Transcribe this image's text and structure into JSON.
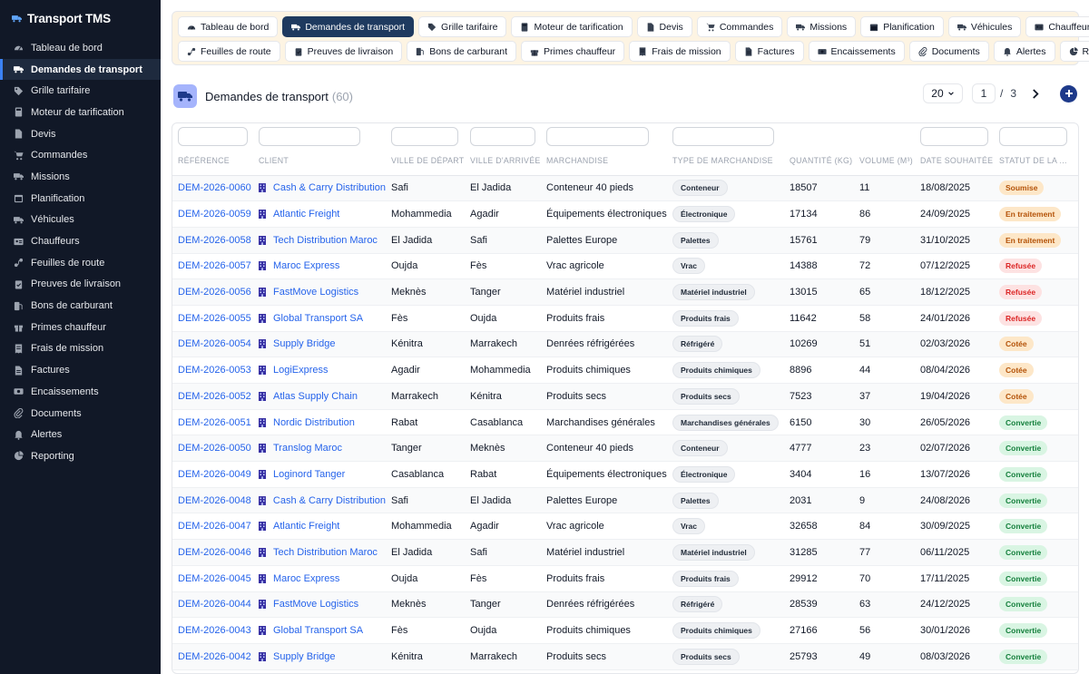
{
  "app": {
    "brand": "Transport TMS"
  },
  "sidebar": {
    "items": [
      {
        "label": "Tableau de bord",
        "icon": "dashboard-icon",
        "active": false
      },
      {
        "label": "Demandes de transport",
        "icon": "truck-icon",
        "active": true
      },
      {
        "label": "Grille tarifaire",
        "icon": "tag-icon",
        "active": false
      },
      {
        "label": "Moteur de tarification",
        "icon": "calculator-icon",
        "active": false
      },
      {
        "label": "Devis",
        "icon": "document-icon",
        "active": false
      },
      {
        "label": "Commandes",
        "icon": "cart-icon",
        "active": false
      },
      {
        "label": "Missions",
        "icon": "truck-icon",
        "active": false
      },
      {
        "label": "Planification",
        "icon": "calendar-icon",
        "active": false
      },
      {
        "label": "Véhicules",
        "icon": "truck-icon",
        "active": false
      },
      {
        "label": "Chauffeurs",
        "icon": "id-card-icon",
        "active": false
      },
      {
        "label": "Feuilles de route",
        "icon": "route-icon",
        "active": false
      },
      {
        "label": "Preuves de livraison",
        "icon": "clipboard-check-icon",
        "active": false
      },
      {
        "label": "Bons de carburant",
        "icon": "fuel-icon",
        "active": false
      },
      {
        "label": "Primes chauffeur",
        "icon": "gift-icon",
        "active": false
      },
      {
        "label": "Frais de mission",
        "icon": "receipt-icon",
        "active": false
      },
      {
        "label": "Factures",
        "icon": "invoice-icon",
        "active": false
      },
      {
        "label": "Encaissements",
        "icon": "money-icon",
        "active": false
      },
      {
        "label": "Documents",
        "icon": "paperclip-icon",
        "active": false
      },
      {
        "label": "Alertes",
        "icon": "bell-icon",
        "active": false
      },
      {
        "label": "Reporting",
        "icon": "pie-chart-icon",
        "active": false
      }
    ]
  },
  "tabs": {
    "row1": [
      {
        "label": "Tableau de bord",
        "icon": "dashboard-icon",
        "active": false
      },
      {
        "label": "Demandes de transport",
        "icon": "truck-icon",
        "active": true
      },
      {
        "label": "Grille tarifaire",
        "icon": "tag-icon",
        "active": false
      },
      {
        "label": "Moteur de tarification",
        "icon": "calculator-icon",
        "active": false
      },
      {
        "label": "Devis",
        "icon": "document-icon",
        "active": false
      },
      {
        "label": "Commandes",
        "icon": "cart-icon",
        "active": false
      },
      {
        "label": "Missions",
        "icon": "truck-icon",
        "active": false
      },
      {
        "label": "Planification",
        "icon": "calendar-icon",
        "active": false
      },
      {
        "label": "Véhicules",
        "icon": "truck-icon",
        "active": false
      },
      {
        "label": "Chauffeurs",
        "icon": "id-card-icon",
        "active": false
      }
    ],
    "row2": [
      {
        "label": "Feuilles de route",
        "icon": "route-icon",
        "active": false
      },
      {
        "label": "Preuves de livraison",
        "icon": "clipboard-check-icon",
        "active": false
      },
      {
        "label": "Bons de carburant",
        "icon": "fuel-icon",
        "active": false
      },
      {
        "label": "Primes chauffeur",
        "icon": "gift-icon",
        "active": false
      },
      {
        "label": "Frais de mission",
        "icon": "receipt-icon",
        "active": false
      },
      {
        "label": "Factures",
        "icon": "invoice-icon",
        "active": false
      },
      {
        "label": "Encaissements",
        "icon": "money-icon",
        "active": false
      },
      {
        "label": "Documents",
        "icon": "paperclip-icon",
        "active": false
      },
      {
        "label": "Alertes",
        "icon": "bell-icon",
        "active": false
      },
      {
        "label": "Reporting",
        "icon": "pie-chart-icon",
        "active": false
      }
    ]
  },
  "header": {
    "title": "Demandes de transport",
    "count": "(60)",
    "per_page": "20",
    "page": "1",
    "page_separator": "/",
    "total_pages": "3"
  },
  "table": {
    "columns": [
      "Référence",
      "Client",
      "Ville de départ",
      "Ville d'arrivée",
      "Marchandise",
      "Type de marchandise",
      "Quantité (kg)",
      "Volume (m³)",
      "Date souhaitée",
      "Statut de la ..."
    ],
    "rows": [
      [
        "DEM-2026-0060",
        "Cash & Carry Distribution",
        "Safi",
        "El Jadida",
        "Conteneur 40 pieds",
        "Conteneur",
        "18507",
        "11",
        "18/08/2025",
        "Soumise"
      ],
      [
        "DEM-2026-0059",
        "Atlantic Freight",
        "Mohammedia",
        "Agadir",
        "Équipements électroniques",
        "Électronique",
        "17134",
        "86",
        "24/09/2025",
        "En traitement"
      ],
      [
        "DEM-2026-0058",
        "Tech Distribution Maroc",
        "El Jadida",
        "Safi",
        "Palettes Europe",
        "Palettes",
        "15761",
        "79",
        "31/10/2025",
        "En traitement"
      ],
      [
        "DEM-2026-0057",
        "Maroc Express",
        "Oujda",
        "Fès",
        "Vrac agricole",
        "Vrac",
        "14388",
        "72",
        "07/12/2025",
        "Refusée"
      ],
      [
        "DEM-2026-0056",
        "FastMove Logistics",
        "Meknès",
        "Tanger",
        "Matériel industriel",
        "Matériel industriel",
        "13015",
        "65",
        "18/12/2025",
        "Refusée"
      ],
      [
        "DEM-2026-0055",
        "Global Transport SA",
        "Fès",
        "Oujda",
        "Produits frais",
        "Produits frais",
        "11642",
        "58",
        "24/01/2026",
        "Refusée"
      ],
      [
        "DEM-2026-0054",
        "Supply Bridge",
        "Kénitra",
        "Marrakech",
        "Denrées réfrigérées",
        "Réfrigéré",
        "10269",
        "51",
        "02/03/2026",
        "Cotée"
      ],
      [
        "DEM-2026-0053",
        "LogiExpress",
        "Agadir",
        "Mohammedia",
        "Produits chimiques",
        "Produits chimiques",
        "8896",
        "44",
        "08/04/2026",
        "Cotée"
      ],
      [
        "DEM-2026-0052",
        "Atlas Supply Chain",
        "Marrakech",
        "Kénitra",
        "Produits secs",
        "Produits secs",
        "7523",
        "37",
        "19/04/2026",
        "Cotée"
      ],
      [
        "DEM-2026-0051",
        "Nordic Distribution",
        "Rabat",
        "Casablanca",
        "Marchandises générales",
        "Marchandises générales",
        "6150",
        "30",
        "26/05/2026",
        "Convertie"
      ],
      [
        "DEM-2026-0050",
        "Translog Maroc",
        "Tanger",
        "Meknès",
        "Conteneur 40 pieds",
        "Conteneur",
        "4777",
        "23",
        "02/07/2026",
        "Convertie"
      ],
      [
        "DEM-2026-0049",
        "Loginord Tanger",
        "Casablanca",
        "Rabat",
        "Équipements électroniques",
        "Électronique",
        "3404",
        "16",
        "13/07/2026",
        "Convertie"
      ],
      [
        "DEM-2026-0048",
        "Cash & Carry Distribution",
        "Safi",
        "El Jadida",
        "Palettes Europe",
        "Palettes",
        "2031",
        "9",
        "24/08/2026",
        "Convertie"
      ],
      [
        "DEM-2026-0047",
        "Atlantic Freight",
        "Mohammedia",
        "Agadir",
        "Vrac agricole",
        "Vrac",
        "32658",
        "84",
        "30/09/2025",
        "Convertie"
      ],
      [
        "DEM-2026-0046",
        "Tech Distribution Maroc",
        "El Jadida",
        "Safi",
        "Matériel industriel",
        "Matériel industriel",
        "31285",
        "77",
        "06/11/2025",
        "Convertie"
      ],
      [
        "DEM-2026-0045",
        "Maroc Express",
        "Oujda",
        "Fès",
        "Produits frais",
        "Produits frais",
        "29912",
        "70",
        "17/11/2025",
        "Convertie"
      ],
      [
        "DEM-2026-0044",
        "FastMove Logistics",
        "Meknès",
        "Tanger",
        "Denrées réfrigérées",
        "Réfrigéré",
        "28539",
        "63",
        "24/12/2025",
        "Convertie"
      ],
      [
        "DEM-2026-0043",
        "Global Transport SA",
        "Fès",
        "Oujda",
        "Produits chimiques",
        "Produits chimiques",
        "27166",
        "56",
        "30/01/2026",
        "Convertie"
      ],
      [
        "DEM-2026-0042",
        "Supply Bridge",
        "Kénitra",
        "Marrakech",
        "Produits secs",
        "Produits secs",
        "25793",
        "49",
        "08/03/2026",
        "Convertie"
      ]
    ]
  },
  "colors": {
    "sidebar_bg": "#111827",
    "accent": "#1e3a5f",
    "link": "#2563eb",
    "tabs_bg": "#fdf4e3"
  }
}
